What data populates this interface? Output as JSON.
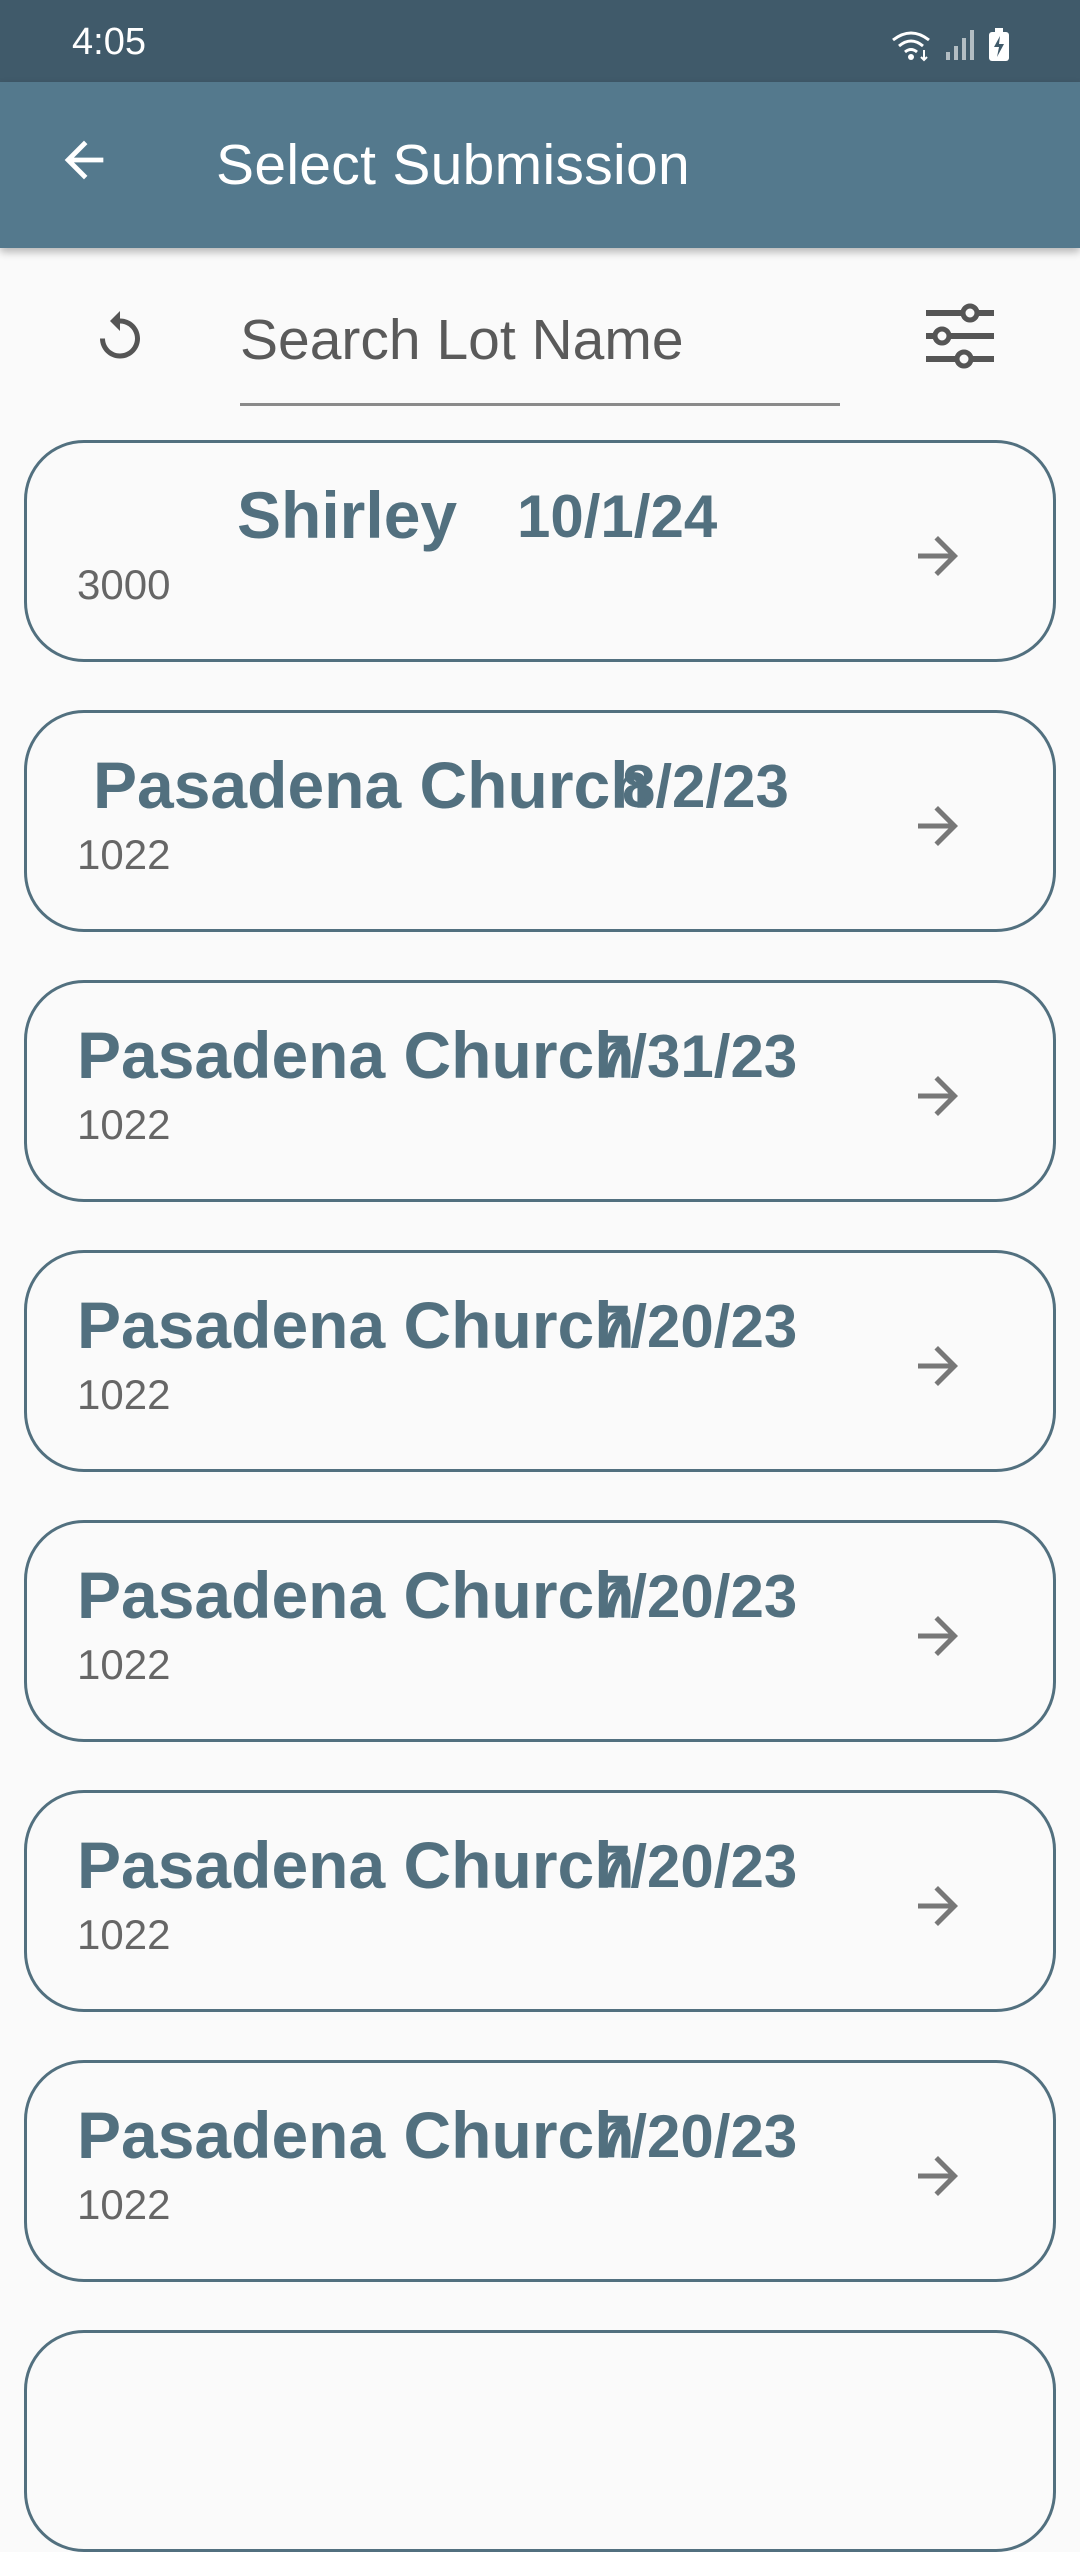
{
  "status_bar": {
    "time": "4:05",
    "icons": [
      "wifi-icon",
      "signal-icon",
      "battery-charging-icon"
    ]
  },
  "app_bar": {
    "title": "Select Submission",
    "back_icon": "arrow-left-icon"
  },
  "search": {
    "placeholder": "Search Lot Name",
    "value": "",
    "refresh_icon": "refresh-icon",
    "filter_icon": "sliders-icon"
  },
  "submissions": [
    {
      "name": "Shirley",
      "date": "10/1/24",
      "code": "3000"
    },
    {
      "name": "Pasadena Church",
      "date": "8/2/23",
      "code": "1022"
    },
    {
      "name": "Pasadena Church",
      "date": "7/31/23",
      "code": "1022"
    },
    {
      "name": "Pasadena Church",
      "date": "7/20/23",
      "code": "1022"
    },
    {
      "name": "Pasadena Church",
      "date": "7/20/23",
      "code": "1022"
    },
    {
      "name": "Pasadena Church",
      "date": "7/20/23",
      "code": "1022"
    },
    {
      "name": "Pasadena Church",
      "date": "7/20/23",
      "code": "1022"
    }
  ],
  "colors": {
    "status_bar": "#405a6a",
    "app_bar": "#54798d",
    "accent_text": "#52707f",
    "background": "#fafafa"
  }
}
